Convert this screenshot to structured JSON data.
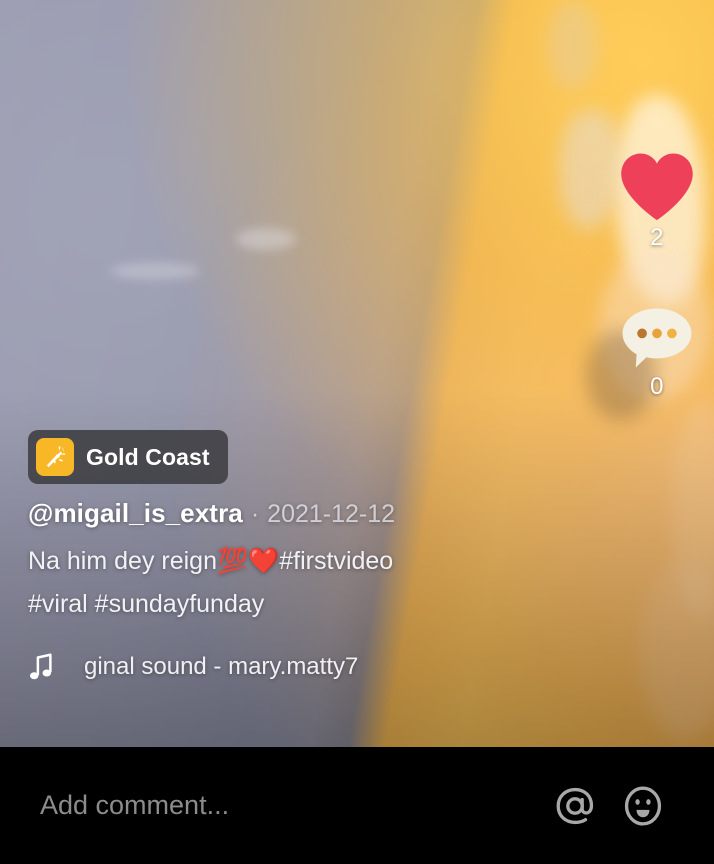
{
  "app": {
    "name": "tiktok-video-player"
  },
  "video": {
    "badge": {
      "icon": "magic-wand-sparkle-icon",
      "label": "Gold Coast",
      "icon_bg": "#f8b726"
    },
    "author": {
      "handle": "@migail_is_extra",
      "separator": "·",
      "date": "2021-12-12"
    },
    "caption": {
      "line1_text": "Na him dey reign",
      "emoji_100": "💯",
      "emoji_heart": "❤️",
      "hashtag1": "#firstvideo",
      "line2": "#viral #sundayfunday"
    },
    "sound": {
      "icon": "music-note-icon",
      "title": "ginal sound - mary.matty7"
    },
    "avatar": {
      "name": "author-avatar",
      "alt": "profile photo"
    },
    "disc": {
      "name": "spinning-record-disc"
    }
  },
  "actions": {
    "like": {
      "icon": "heart-icon",
      "count": "2",
      "color": "#ee4058"
    },
    "comment": {
      "icon": "comment-bubble-icon",
      "count": "0",
      "color": "#f4f1e4"
    },
    "more": {
      "icon": "more-options-dots-icon",
      "highlight_color": "#e51c23"
    }
  },
  "comment_bar": {
    "placeholder": "Add comment...",
    "mention_icon": "at-mention-icon",
    "emoji_icon": "emoji-smiley-icon"
  }
}
